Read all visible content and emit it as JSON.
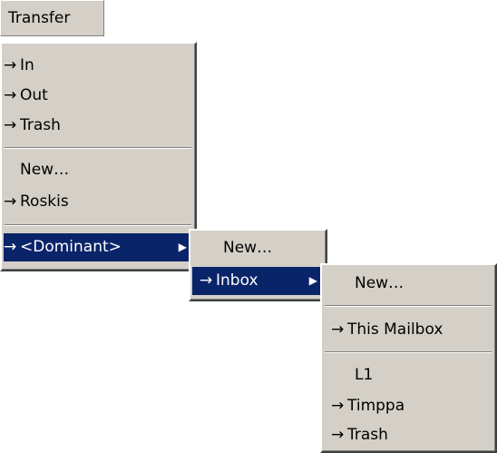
{
  "menubar": {
    "transfer_label": "Transfer"
  },
  "arrow_glyph": "→",
  "submenu_glyph": "▶",
  "transfer_menu": {
    "items": [
      {
        "label": "In",
        "arrow": true
      },
      {
        "label": "Out",
        "arrow": true
      },
      {
        "label": "Trash",
        "arrow": true
      },
      {
        "label": "New…",
        "arrow": false
      },
      {
        "label": "Roskis",
        "arrow": true
      },
      {
        "label": "<Dominant>",
        "arrow": true,
        "submenu": true,
        "selected": true
      }
    ]
  },
  "dominant_menu": {
    "items": [
      {
        "label": "New…",
        "arrow": false
      },
      {
        "label": "Inbox",
        "arrow": true,
        "submenu": true,
        "selected": true
      }
    ]
  },
  "inbox_menu": {
    "items": [
      {
        "label": "New…",
        "arrow": false
      },
      {
        "label": "This Mailbox",
        "arrow": true
      },
      {
        "label": "L1",
        "arrow": false
      },
      {
        "label": "Timppa",
        "arrow": true
      },
      {
        "label": "Trash",
        "arrow": true
      }
    ]
  },
  "colors": {
    "menu_background": "#d4d0c8",
    "selection_background": "#0a246a",
    "selection_text": "#ffffff"
  }
}
